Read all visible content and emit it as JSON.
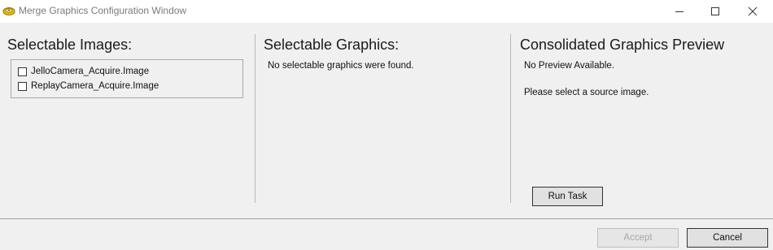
{
  "window": {
    "title": "Merge Graphics Configuration Window"
  },
  "panels": {
    "images": {
      "title": "Selectable Images:",
      "items": [
        {
          "label": "JelloCamera_Acquire.Image",
          "checked": false
        },
        {
          "label": "ReplayCamera_Acquire.Image",
          "checked": false
        }
      ]
    },
    "graphics": {
      "title": "Selectable Graphics:",
      "message": "No selectable graphics were found."
    },
    "preview": {
      "title": "Consolidated Graphics Preview",
      "status": "No Preview Available.",
      "hint": "Please select a source image.",
      "run_label": "Run Task"
    }
  },
  "footer": {
    "accept_label": "Accept",
    "accept_enabled": false,
    "cancel_label": "Cancel"
  },
  "colors": {
    "window_bg": "#f0f0f0",
    "titlebar_bg": "#ffffff",
    "icon_accent": "#e0a800"
  },
  "icons": {
    "app": "merge-graphics-app-icon",
    "minimize": "minimize-icon",
    "maximize": "maximize-icon",
    "close": "close-icon"
  }
}
